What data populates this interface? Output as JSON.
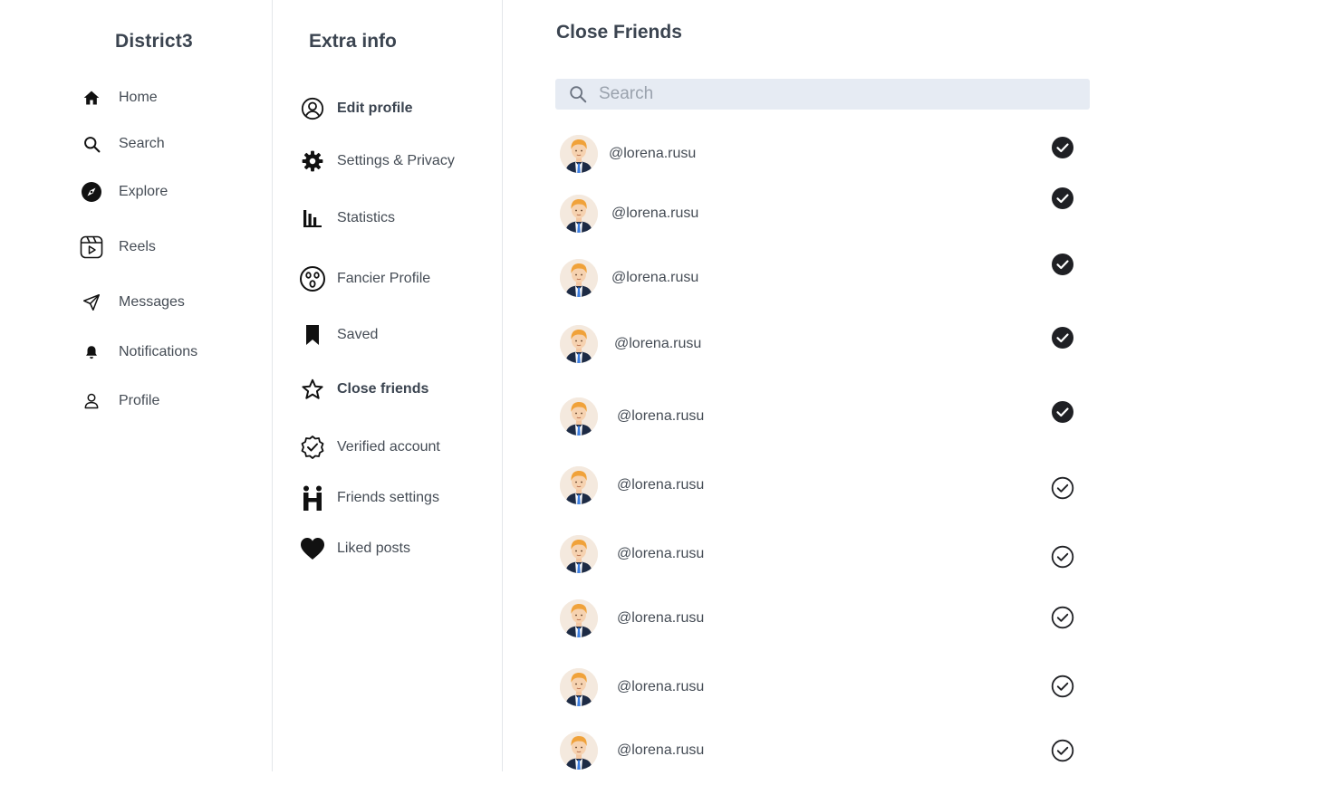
{
  "app": {
    "brand": "District3"
  },
  "nav": {
    "items": [
      {
        "label": "Home",
        "icon": "home-icon"
      },
      {
        "label": "Search",
        "icon": "search-icon"
      },
      {
        "label": "Explore",
        "icon": "compass-icon"
      },
      {
        "label": "Reels",
        "icon": "reels-icon"
      },
      {
        "label": "Messages",
        "icon": "send-icon"
      },
      {
        "label": "Notifications",
        "icon": "bell-icon"
      },
      {
        "label": "Profile",
        "icon": "user-icon"
      }
    ]
  },
  "extra": {
    "title": "Extra info",
    "items": [
      {
        "label": "Edit profile",
        "icon": "user-circle-icon"
      },
      {
        "label": "Settings & Privacy",
        "icon": "gear-icon"
      },
      {
        "label": "Statistics",
        "icon": "bar-chart-icon"
      },
      {
        "label": "Fancier Profile",
        "icon": "surprised-face-icon"
      },
      {
        "label": "Saved",
        "icon": "bookmark-icon"
      },
      {
        "label": "Close friends",
        "icon": "star-icon"
      },
      {
        "label": "Verified account",
        "icon": "verified-badge-icon"
      },
      {
        "label": "Friends settings",
        "icon": "friends-icon"
      },
      {
        "label": "Liked posts",
        "icon": "heart-icon"
      }
    ],
    "active": "Close friends"
  },
  "close_friends": {
    "title": "Close Friends",
    "search_placeholder": "Search",
    "friends": [
      {
        "handle": "@lorena.rusu",
        "selected": true
      },
      {
        "handle": "@lorena.rusu",
        "selected": true
      },
      {
        "handle": "@lorena.rusu",
        "selected": true
      },
      {
        "handle": "@lorena.rusu",
        "selected": true
      },
      {
        "handle": "@lorena.rusu",
        "selected": true
      },
      {
        "handle": "@lorena.rusu",
        "selected": false
      },
      {
        "handle": "@lorena.rusu",
        "selected": false
      },
      {
        "handle": "@lorena.rusu",
        "selected": false
      },
      {
        "handle": "@lorena.rusu",
        "selected": false
      },
      {
        "handle": "@lorena.rusu",
        "selected": false
      }
    ]
  },
  "colors": {
    "text": "#3b4450",
    "search_bg": "#e6ebf3",
    "divider": "#e4e6ea",
    "check": "#1f2024"
  }
}
